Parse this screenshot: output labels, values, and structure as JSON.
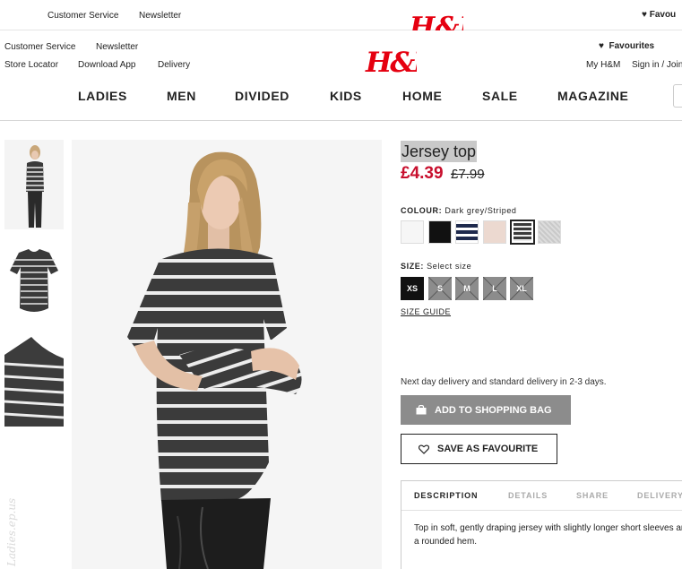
{
  "ghost_header": {
    "customer_service": "Customer Service",
    "newsletter": "Newsletter",
    "favourites": "Favou"
  },
  "header": {
    "customer_service": "Customer Service",
    "newsletter": "Newsletter",
    "store_locator": "Store Locator",
    "download_app": "Download App",
    "delivery": "Delivery",
    "logo_text": "H&M",
    "favourites": "Favourites",
    "my_hm": "My H&M",
    "sign_in": "Sign in / Join"
  },
  "nav": [
    "LADIES",
    "MEN",
    "DIVIDED",
    "KIDS",
    "HOME",
    "SALE",
    "MAGAZINE"
  ],
  "watermark": "Ladies.ep.us",
  "product": {
    "title": "Jersey top",
    "price": "£4.39",
    "old_price": "£7.99",
    "colour_label": "COLOUR:",
    "colour_value": "Dark grey/Striped",
    "colours": [
      "#f6f6f6",
      "#111111",
      "stripe-navy",
      "#ecd9d0",
      "stripe-dark",
      "#cfcfcf"
    ],
    "selected_colour": 4,
    "size_label": "SIZE:",
    "size_value": "Select size",
    "sizes": [
      {
        "label": "XS",
        "available": true
      },
      {
        "label": "S",
        "available": false
      },
      {
        "label": "M",
        "available": false
      },
      {
        "label": "L",
        "available": false
      },
      {
        "label": "XL",
        "available": false
      }
    ],
    "size_guide": "SIZE GUIDE",
    "delivery_text": "Next day delivery and standard delivery in 2-3 days.",
    "add_to_bag": "ADD TO SHOPPING BAG",
    "save_favourite": "SAVE AS FAVOURITE",
    "tabs": [
      "DESCRIPTION",
      "DETAILS",
      "SHARE",
      "DELIVERY"
    ],
    "description": "Top in soft, gently draping jersey with slightly longer short sleeves and a rounded hem."
  },
  "colors": {
    "sale_red": "#c8102e",
    "logo_red": "#e50010",
    "button_grey": "#8c8c8c"
  }
}
